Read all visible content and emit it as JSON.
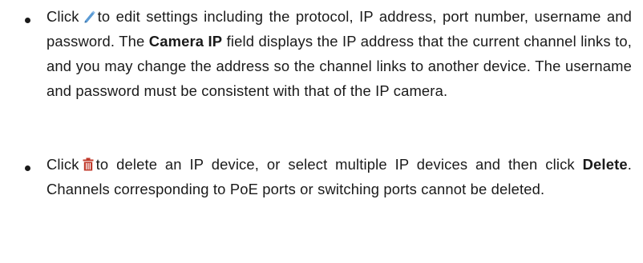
{
  "bullets": [
    {
      "before_icon": "Click",
      "icon": "pencil-edit-icon",
      "after_icon": "to edit settings including the protocol, IP address, port number, username and password. The",
      "bold_1": "Camera IP",
      "after_bold_1": "field displays the IP address that the current channel links to, and you may change the address so the channel links to another device. The username and password must be consistent with that of the IP camera."
    },
    {
      "before_icon": "Click",
      "icon": "trash-delete-icon",
      "after_icon": "to delete an IP device, or select multiple IP devices and then click",
      "bold_1": "Delete",
      "after_bold_1": ". Channels corresponding to PoE ports or switching ports cannot be deleted."
    }
  ],
  "colors": {
    "text": "#1a1a1a",
    "edit_icon": "#5b9bd5",
    "delete_icon": "#c0392b"
  }
}
